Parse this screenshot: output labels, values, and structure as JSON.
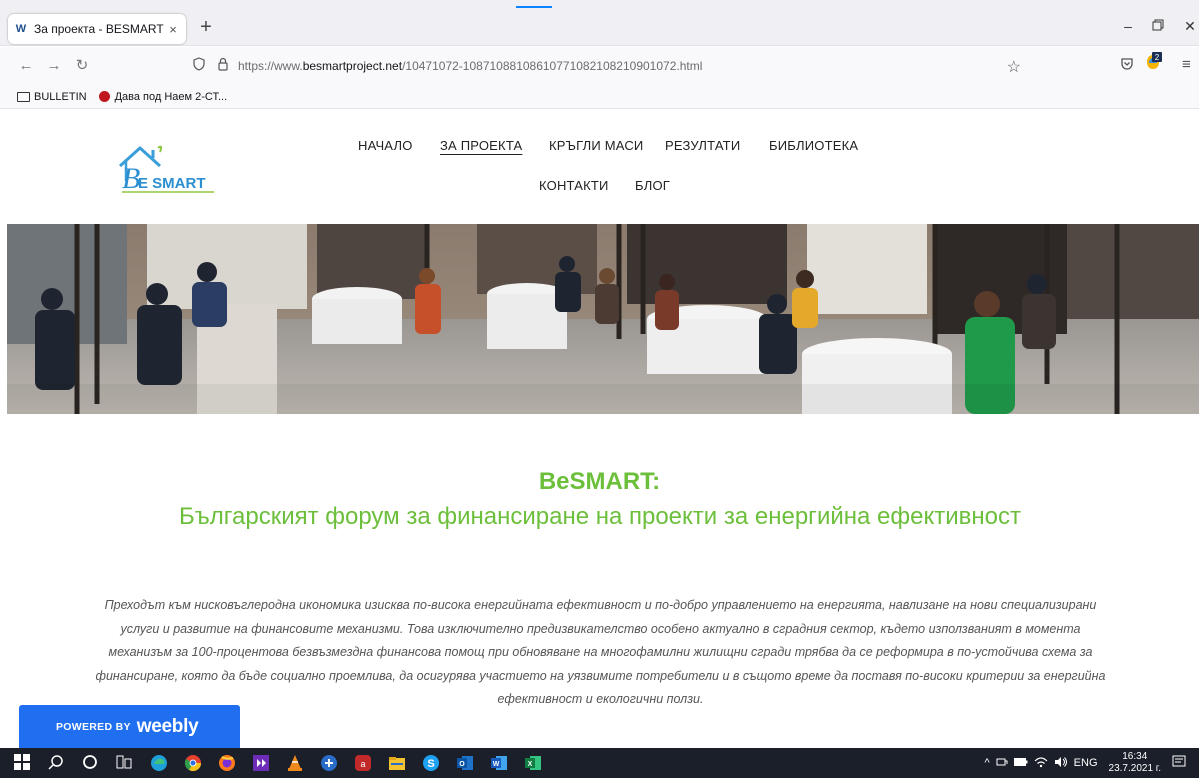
{
  "browser": {
    "tab_title": "За проекта - BESMART PROJEC",
    "tab_close": "×",
    "new_tab": "+",
    "url_prefix": "https://www.",
    "url_domain": "besmartproject.net",
    "url_path": "/10471072-10871088108610771082108210901072.html",
    "bookmarks": [
      "BULLETIN",
      "Дава под Наем 2-СТ..."
    ],
    "ext_badge": "2"
  },
  "site": {
    "logo_text": "E SMART",
    "logo_b": "B",
    "nav": [
      "НАЧАЛО",
      "ЗА ПРОЕКТА",
      "КРЪГЛИ МАСИ",
      "РЕЗУЛТАТИ",
      "БИБЛИОТЕКА",
      "КОНТАКТИ",
      "БЛОГ"
    ],
    "active_nav": "ЗА ПРОЕКТА"
  },
  "content": {
    "heading_bold": "BeSMART:",
    "heading_sub": "Българският форум за финансиране на проекти за енергийна ефективност",
    "paragraph": "Преходът към нисковъглеродна икономика изисква по-висока енергийната ефективност и по-добро управлението на енергията, навлизане на нови специализирани услуги и развитие на финансовите механизми. Това изключително предизвикателство особено актуално в сградния сектор, където използваният в момента механизъм за 100-процентова безвъзмездна финансова помощ при обновяване на многофамилни жилищни сгради трябва да се реформира в по-устойчива схема за финансиране, която да бъде социално проемлива, да осигурява участието на уязвимите потребители и в същото време да поставя по-високи критерии за енергийна ефективност и екологични ползи."
  },
  "weebly": {
    "powered_by": "POWERED BY",
    "brand": "weebly"
  },
  "taskbar": {
    "lang": "ENG",
    "time": "16:34",
    "date": "23.7.2021 г."
  },
  "colors": {
    "accent_green": "#6cbf3b",
    "weebly_blue": "#1f6ff0",
    "taskbar": "#1b1f2a"
  }
}
